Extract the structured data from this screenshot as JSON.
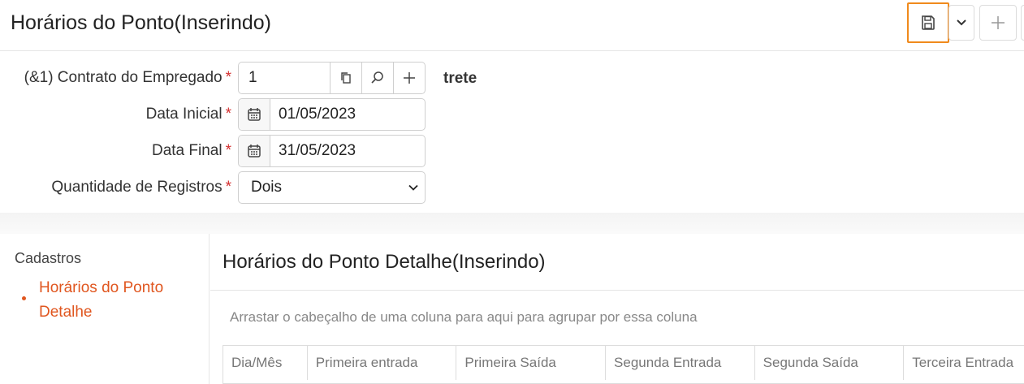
{
  "header": {
    "title": "Horários do Ponto(Inserindo)"
  },
  "form": {
    "contract": {
      "label": "(&1) Contrato do Empregado",
      "value": "1",
      "description": "trete"
    },
    "start_date": {
      "label": "Data Inicial",
      "value": "01/05/2023"
    },
    "end_date": {
      "label": "Data Final",
      "value": "31/05/2023"
    },
    "record_count": {
      "label": "Quantidade de Registros",
      "value": "Dois"
    },
    "required_mark": "*"
  },
  "sidebar": {
    "title": "Cadastros",
    "items": [
      {
        "label": "Horários do Ponto Detalhe"
      }
    ]
  },
  "detail": {
    "title": "Horários do Ponto Detalhe(Inserindo)",
    "group_hint": "Arrastar o cabeçalho de uma coluna para aqui para agrupar por essa coluna",
    "columns": [
      "Dia/Mês",
      "Primeira entrada",
      "Primeira Saída",
      "Segunda Entrada",
      "Segunda Saída",
      "Terceira Entrada"
    ]
  },
  "colors": {
    "accent": "#e0561f",
    "save_highlight": "#f08a1c",
    "required": "#d32f2f"
  },
  "icons": [
    "save-icon",
    "chevron-down-icon",
    "plus-icon",
    "copy-icon",
    "search-icon",
    "calendar-icon"
  ]
}
